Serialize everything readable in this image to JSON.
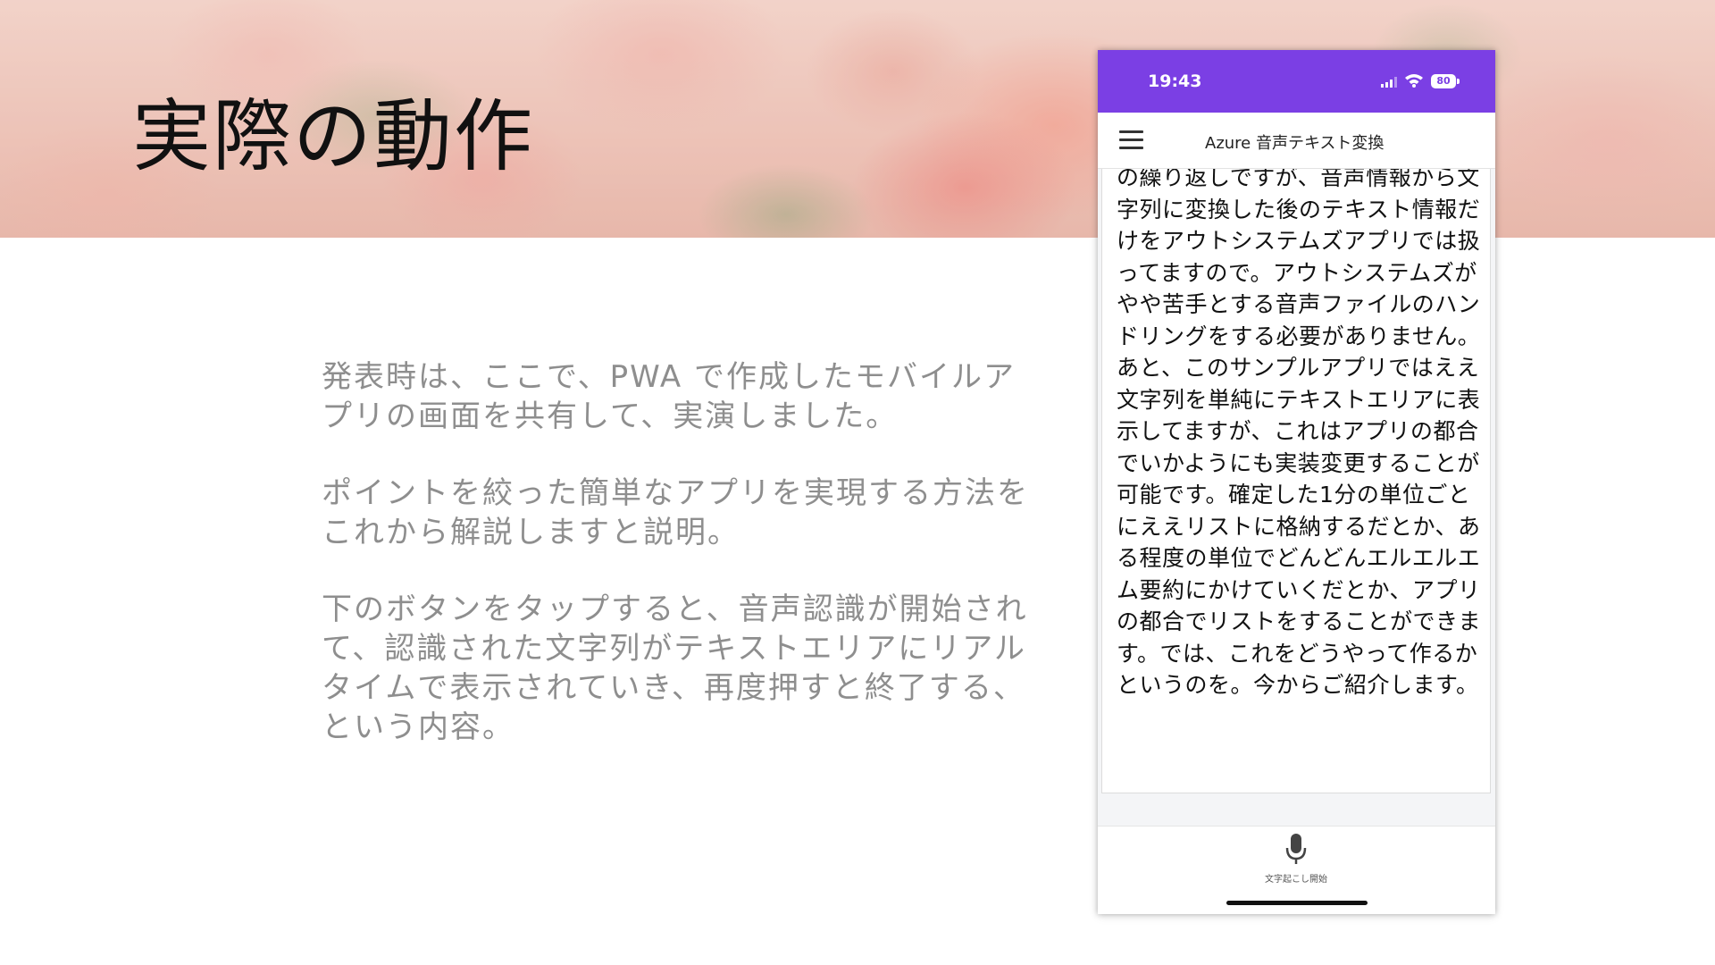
{
  "slide": {
    "title": "実際の動作",
    "paragraphs": [
      "発表時は、ここで、PWA で作成したモバイルアプリの画面を共有して、実演しました。",
      "ポイントを絞った簡単なアプリを実現する方法をこれから解説しますと説明。",
      "下のボタンをタップすると、音声認識が開始されて、認識された文字列がテキストエリアにリアルタイムで表示されていき、再度押すと終了する、という内容。"
    ]
  },
  "phone": {
    "status_bar": {
      "time": "19:43",
      "battery": "80",
      "color": "#7b3fe4"
    },
    "app_bar": {
      "menu_icon": "hamburger-menu-icon",
      "title": "Azure 音声テキスト変換"
    },
    "transcript": "の繰り返しですが、音声情報から文字列に変換した後のテキスト情報だけをアウトシステムズアプリでは扱ってますので。アウトシステムズがやや苦手とする音声ファイルのハンドリングをする必要がありません。あと、このサンプルアプリではええ文字列を単純にテキストエリアに表示してますが、これはアプリの都合でいかようにも実装変更することが可能です。確定した1分の単位ごとにええリストに格納するだとか、ある程度の単位でどんどんエルエルエム要約にかけていくだとか、アプリの都合でリストをすることができます。では、これをどうやって作るかというのを。今からご紹介します。",
    "mic_button": {
      "icon": "microphone-icon",
      "label": "文字起こし開始"
    }
  }
}
